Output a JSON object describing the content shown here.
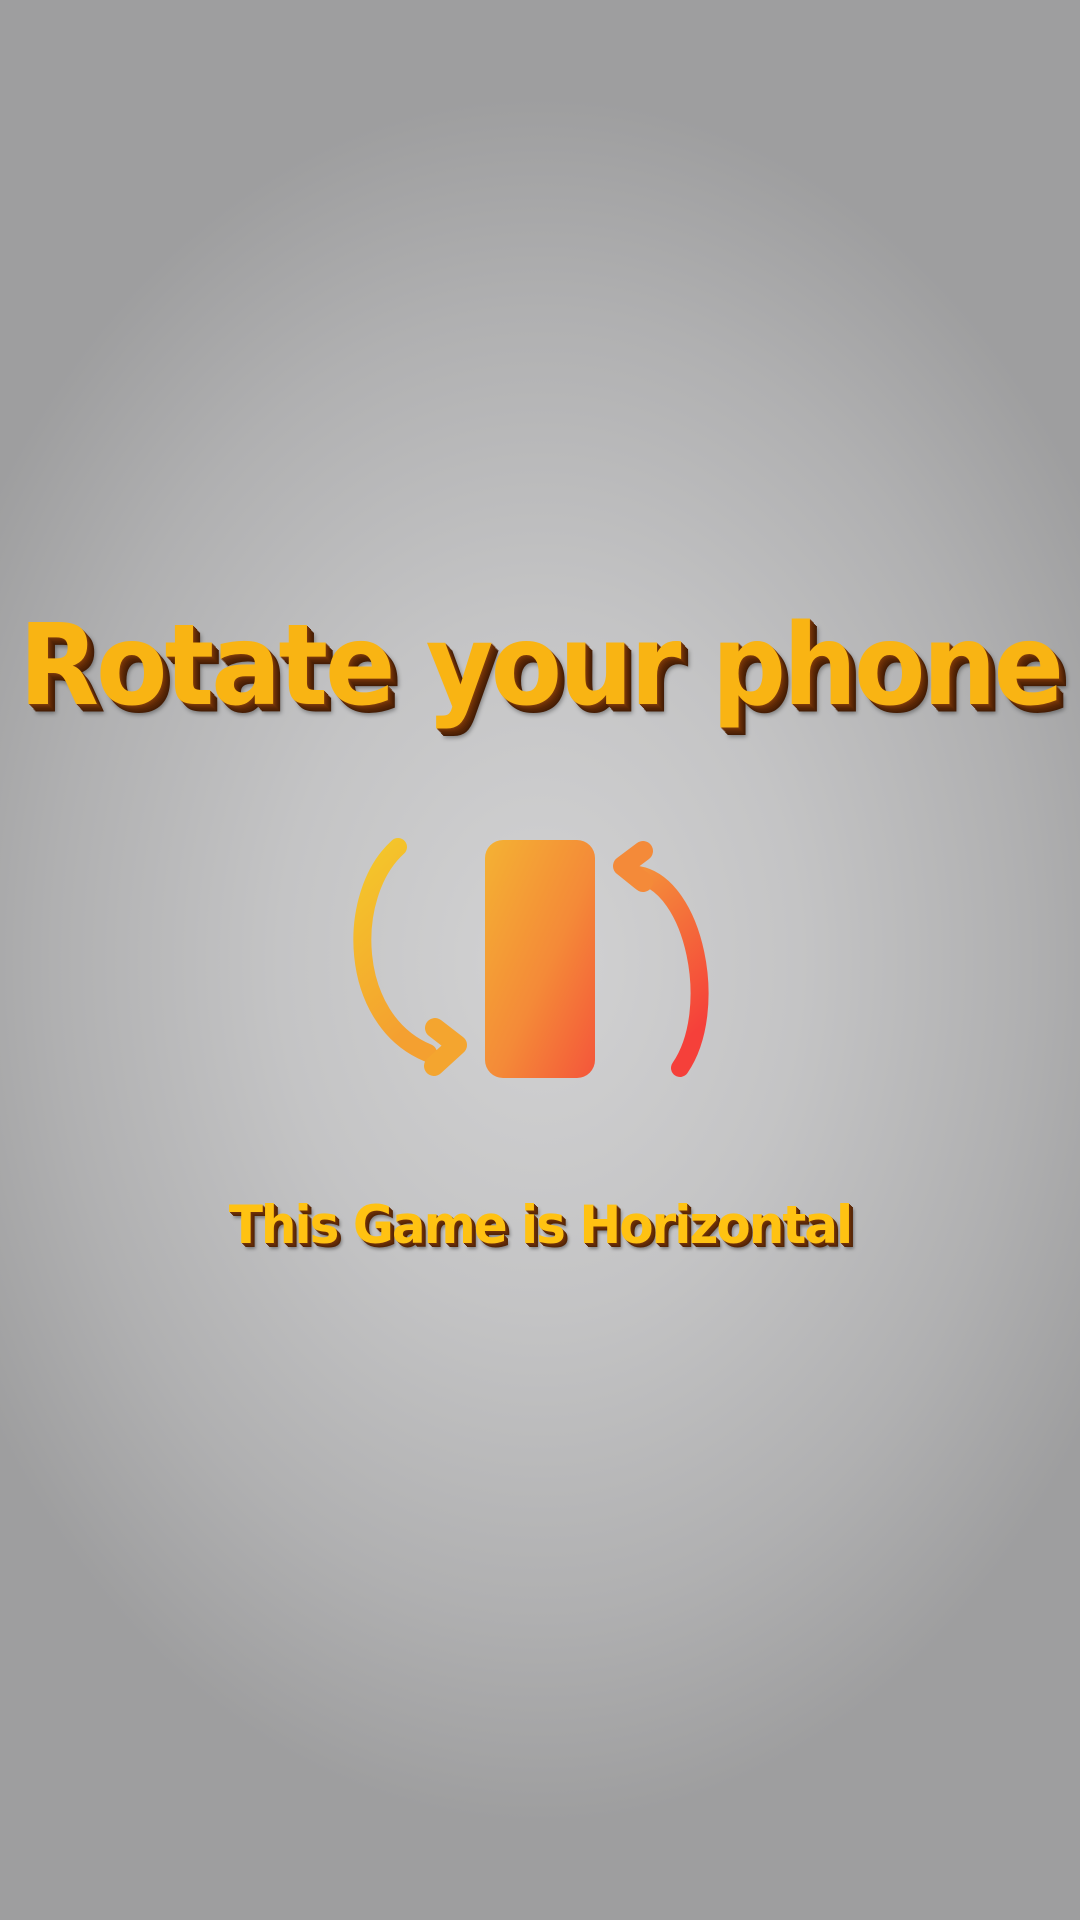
{
  "screen": {
    "title": "Rotate your phone",
    "subtitle": "This Game is Horizontal",
    "icon": "rotate-phone-icon"
  },
  "colors": {
    "title_fill": "#f9b413",
    "title_shadow": "#542405",
    "icon_gradient_start": "#f4c72a",
    "icon_gradient_mid": "#f4883a",
    "icon_gradient_end": "#f5423a",
    "background_center": "#d2d2d3",
    "background_edge": "#9e9e9f"
  }
}
